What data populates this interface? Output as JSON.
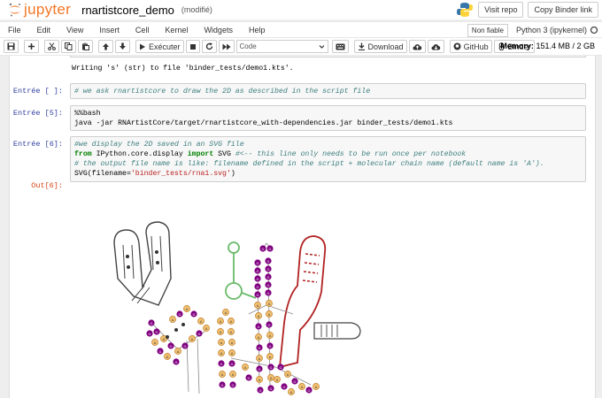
{
  "header": {
    "logo_text": "jupyter",
    "notebook_name": "rnartistcore_demo",
    "status": "(modifié)",
    "visit_repo": "Visit repo",
    "copy_binder": "Copy Binder link"
  },
  "menu": {
    "items": [
      "File",
      "Edit",
      "View",
      "Insert",
      "Cell",
      "Kernel",
      "Widgets",
      "Help"
    ],
    "trusted": "Non fiable",
    "kernel": "Python 3 (ipykernel)"
  },
  "toolbar": {
    "run_label": "Exécuter",
    "cell_type": "Code",
    "download": "Download",
    "github": "GitHub",
    "binder": "Binder",
    "memory_label": "Memory:",
    "memory_value": "151.4 MB / 2 GB"
  },
  "cells": {
    "c0": {
      "stdout": "Writing 's' (str) to file 'binder_tests/demo1.kts'."
    },
    "c1": {
      "prompt": "Entrée [ ]:",
      "line1": "# we ask rnartistcore to draw the 2D as described in the script file"
    },
    "c2": {
      "prompt": "Entrée [5]:",
      "line1": "%%bash",
      "line2_a": "java -jar RNArtistCore/target/rnartistcore_with-dependencies.jar binder_tests/demo1.kts"
    },
    "c3": {
      "prompt": "Entrée [6]:",
      "line1": "#we display the 2D saved in an SVG file",
      "line2_kw1": "from",
      "line2_mod": " IPython.core.display ",
      "line2_kw2": "import",
      "line2_name": " SVG ",
      "line2_comment": "#<-- this line only needs to be run once per notebook",
      "line3": "# the output file name is like: filename defined in the script + molecular chain name (default name is 'A').",
      "line4_a": "SVG(filename=",
      "line4_str": "'binder_tests/rna1.svg'",
      "line4_b": ")",
      "out_prompt": "Out[6]:"
    }
  },
  "colors": {
    "accent": "#f37726",
    "purple": "#800080",
    "orange": "#e8a33d",
    "green": "#6aba6a",
    "red": "#b22222"
  },
  "icons": [
    "save-icon",
    "plus-icon",
    "cut-icon",
    "copy-icon",
    "paste-icon",
    "arrow-up-icon",
    "arrow-down-icon",
    "run-icon",
    "stop-icon",
    "restart-icon",
    "fast-forward-icon",
    "keyboard-icon",
    "download-icon",
    "cloud-upload-icon",
    "cloud-download-icon",
    "github-icon",
    "binder-icon"
  ]
}
